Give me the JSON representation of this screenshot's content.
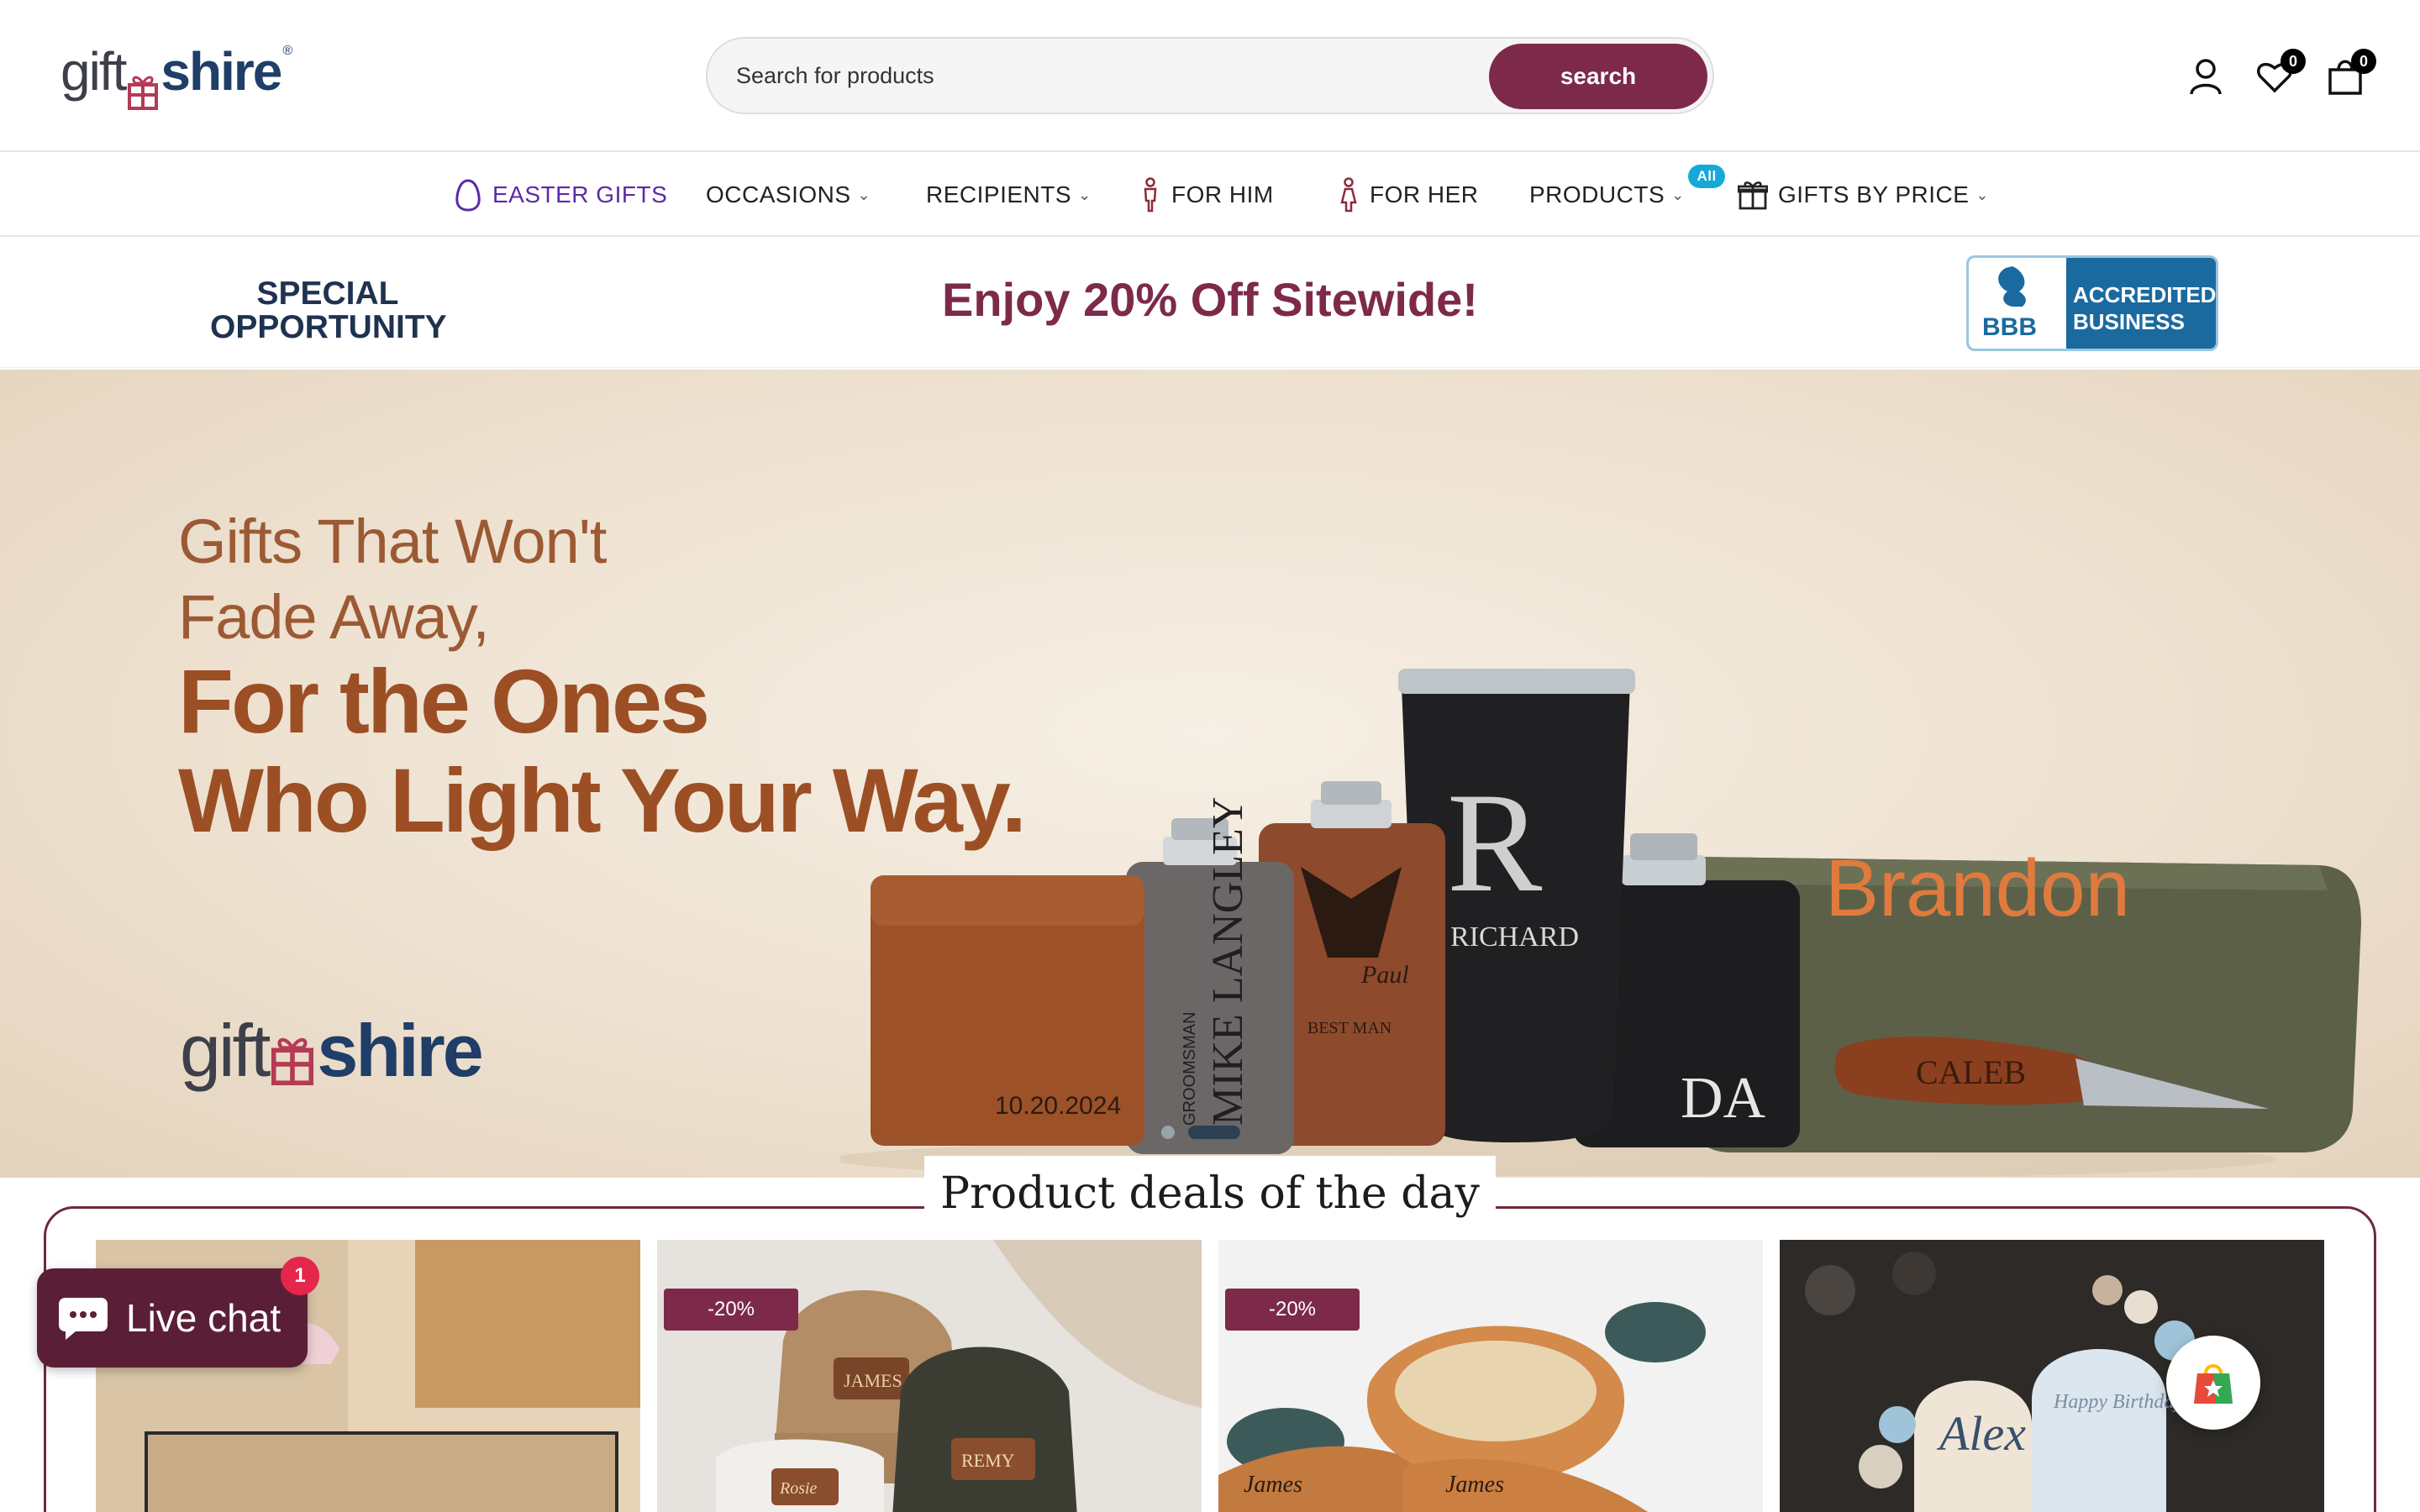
{
  "header": {
    "logo_gift": "gift",
    "logo_shire": "shire",
    "search_placeholder": "Search for products",
    "search_button": "search",
    "wishlist_count": "0",
    "cart_count": "0"
  },
  "nav": {
    "items": [
      {
        "label": "EASTER GIFTS",
        "icon": "egg-icon",
        "color": "#5b2aa8"
      },
      {
        "label": "OCCASIONS",
        "dropdown": true
      },
      {
        "label": "RECIPIENTS",
        "dropdown": true
      },
      {
        "label": "FOR HIM",
        "icon": "man-icon"
      },
      {
        "label": "FOR HER",
        "icon": "woman-icon"
      },
      {
        "label": "PRODUCTS",
        "dropdown": true,
        "badge": "All"
      },
      {
        "label": "GIFTS BY PRICE",
        "icon": "gift-icon",
        "dropdown": true
      }
    ]
  },
  "promo": {
    "special": "SPECIAL OPPORTUNITY",
    "headline": "Enjoy 20% Off Sitewide!",
    "bbb_short": "BBB",
    "bbb_label_1": "ACCREDITED",
    "bbb_label_2": "BUSINESS"
  },
  "hero": {
    "line1a": "Gifts That Won't",
    "line1b": "Fade Away,",
    "line2a": "For the Ones",
    "line2b": "Who Light Your Way.",
    "logo_gift": "gift",
    "logo_shire": "shire",
    "engraving_wallet": "10.20.2024",
    "engraving_flask_gray": "MIKE LANGLEY",
    "engraving_flask_gray_role": "GROOMSMAN",
    "engraving_flask_brown": "Paul",
    "engraving_flask_brown_role": "BEST MAN",
    "engraving_tumbler_letter": "R",
    "engraving_tumbler_name": "RICHARD",
    "engraving_flask_black": "DA",
    "engraving_bag": "Brandon",
    "engraving_knife": "CALEB",
    "slides": 2,
    "active_slide": 2
  },
  "deals": {
    "title": "Product deals of the day",
    "products": [
      {
        "name": "doormat",
        "discount": ""
      },
      {
        "name": "beanies",
        "discount": "-20%",
        "tag1": "JAMES",
        "tag2": "REMY",
        "tag3": "Rosie"
      },
      {
        "name": "baby brushes",
        "discount": "-20%",
        "tag1": "James",
        "tag2": "James"
      },
      {
        "name": "birthday backdrop",
        "discount": "",
        "tag1": "Alex",
        "tag2": "Happy Birthday"
      }
    ]
  },
  "chat": {
    "label": "Live chat",
    "badge": "1"
  },
  "colors": {
    "brand": "#7d2a4a",
    "navy": "#1f3e68",
    "hero_text": "#9c4f24"
  }
}
